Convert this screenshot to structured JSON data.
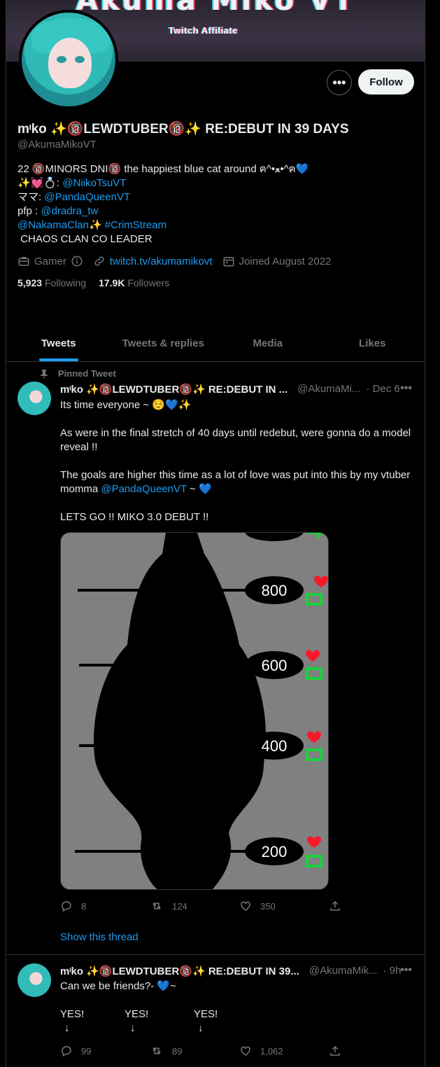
{
  "banner": {
    "title": "Akuma Miko VT",
    "affiliate": "Twitch Affiliate"
  },
  "profile": {
    "more_label": "•••",
    "follow_label": "Follow",
    "name": "mᶦko ✨🔞LEWDTUBER🔞✨ RE:DEBUT IN 39 DAYS",
    "handle": "@AkumaMikoVT",
    "bio": {
      "line1": "22 🔞MINORS DNI🔞 the happiest blue cat around ฅ^•ﻌ•^ฅ💙",
      "line2_prefix": "✨💓💍: ",
      "line2_link": "@NiikoTsuVT",
      "line3_prefix": "ママ: ",
      "line3_link": "@PandaQueenVT",
      "line4_prefix": "pfp : ",
      "line4_link": "@dradra_tw",
      "line5_link1": "@NakamaClan",
      "line5_mid": "✨ ",
      "line5_link2": "#CrimStream",
      "line6": " CHAOS CLAN CO LEADER"
    },
    "category": "Gamer",
    "website": "twitch.tv/akumamikovt",
    "joined": "Joined August 2022",
    "following_count": "5,923",
    "following_label": "Following",
    "followers_count": "17.9K",
    "followers_label": "Followers"
  },
  "tabs": [
    "Tweets",
    "Tweets & replies",
    "Media",
    "Likes"
  ],
  "tweet1": {
    "pinned_label": "Pinned Tweet",
    "name": "mᶦko ✨🔞LEWDTUBER🔞✨ RE:DEBUT IN ...",
    "handle": "@AkumaMi...",
    "time": "· Dec 6",
    "line1": "Its time everyone ~ ☺️💙✨",
    "line2": "As were in the final stretch of 40 days until redebut, were gonna do a model",
    "line3": "reveal !!",
    "line4": "The goals are higher this time as a lot of love was put into this by my vtuber",
    "line5_prefix": "momma ",
    "line5_link": "@PandaQueenVT",
    "line5_suffix": " ~ 💙",
    "line6": "LETS GO !! MIKO 3.0 DEBUT !!",
    "goals": [
      "800",
      "600",
      "400",
      "200"
    ],
    "replies": "8",
    "retweets": "124",
    "likes": "350",
    "thread_link": "Show this thread"
  },
  "tweet2": {
    "name": "mᶦko ✨🔞LEWDTUBER🔞✨ RE:DEBUT IN 39...",
    "handle": "@AkumaMik...",
    "time": "· 9h",
    "line1": "Can we be friends?- 💙~",
    "yes": [
      "YES!",
      "YES!",
      "YES!"
    ],
    "arrow": "↓",
    "replies": "99",
    "retweets": "89",
    "likes": "1,062"
  },
  "colors": {
    "accent": "#1d9bf0",
    "muted": "#71767b",
    "heart": "#f91828",
    "retweet": "#19d13c"
  }
}
